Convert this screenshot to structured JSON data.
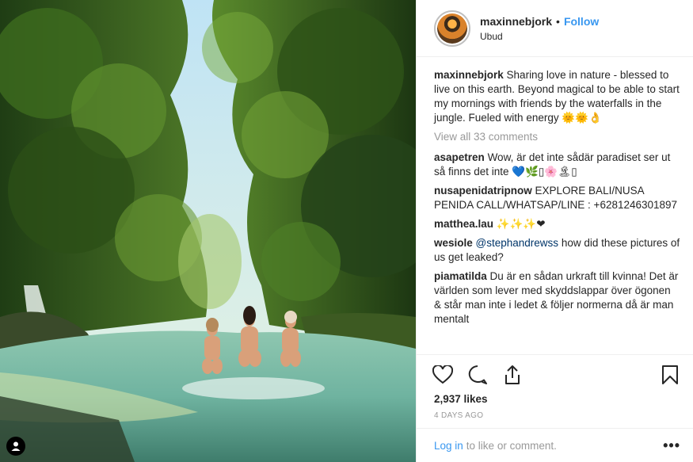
{
  "header": {
    "username": "maxinnebjork",
    "separator": "•",
    "follow_label": "Follow",
    "location": "Ubud"
  },
  "caption": {
    "user": "maxinnebjork",
    "text": "Sharing love in nature - blessed to live on this earth. Beyond magical to be able to start my mornings with friends by the waterfalls in the jungle. Fueled with energy 🌞🌞👌"
  },
  "view_all": "View all 33 comments",
  "comments": [
    {
      "user": "asapetren",
      "text": "Wow, är det inte sådär paradiset ser ut så finns det inte 💙🌿▯🌸🏝▯"
    },
    {
      "user": "nusapenidatripnow",
      "text": "EXPLORE BALI/NUSA PENIDA CALL/WHATSAP/LINE : +6281246301897"
    },
    {
      "user": "matthea.lau",
      "text": "✨✨✨❤"
    },
    {
      "user": "wesiole",
      "mention": "@stephandrewss",
      "text": " how did these pictures of us get leaked?"
    },
    {
      "user": "piamatilda",
      "text": "Du är en sådan urkraft till kvinna! Det är världen som lever med skyddslappar över ögonen & står man inte i ledet & följer normerna då är man mentalt"
    }
  ],
  "likes": "2,937 likes",
  "date": "4 DAYS AGO",
  "login": {
    "link": "Log in",
    "rest": "to like or comment.",
    "more": "•••"
  },
  "colors": {
    "link_blue": "#3897f0",
    "text": "#262626",
    "muted": "#999999",
    "divider": "#efefef"
  },
  "icons": [
    "heart-icon",
    "comment-icon",
    "share-icon",
    "bookmark-icon",
    "tagged-user-icon",
    "more-options-icon"
  ]
}
